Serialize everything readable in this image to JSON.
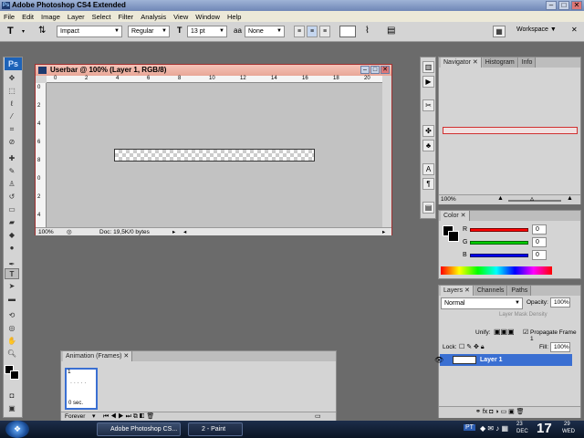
{
  "app": {
    "title": "Adobe Photoshop CS4 Extended",
    "logo": "Ps"
  },
  "menu": [
    "File",
    "Edit",
    "Image",
    "Layer",
    "Select",
    "Filter",
    "Analysis",
    "View",
    "Window",
    "Help"
  ],
  "options": {
    "font_family": "Impact",
    "font_style": "Regular",
    "font_size": "13 pt",
    "antialias_label": "aa",
    "antialias": "None",
    "workspace": "Workspace"
  },
  "document": {
    "title": "Userbar @ 100% (Layer 1, RGB/8)",
    "zoom": "100%",
    "doc_info": "Doc: 19,5K/0 bytes",
    "ruler_h": [
      "0",
      "2",
      "4",
      "6",
      "8",
      "10",
      "12",
      "14",
      "16",
      "18",
      "20"
    ],
    "ruler_v": [
      "0",
      "2",
      "4",
      "6",
      "8",
      "0",
      "2",
      "4"
    ]
  },
  "navigator": {
    "tabs": [
      "Navigator",
      "Histogram",
      "Info"
    ],
    "zoom": "100%"
  },
  "color": {
    "tab": "Color",
    "channels": [
      {
        "label": "R",
        "value": "0"
      },
      {
        "label": "G",
        "value": "0"
      },
      {
        "label": "B",
        "value": "0"
      }
    ],
    "colors": {
      "fg": "#000000",
      "r": "#ff0000",
      "g": "#00c000",
      "b": "#0000ff"
    }
  },
  "layers": {
    "tabs": [
      "Layers",
      "Channels",
      "Paths"
    ],
    "blend_mode": "Normal",
    "opacity_label": "Opacity:",
    "opacity": "100%",
    "mask_density": "Layer Mask Density",
    "unify": "Unify:",
    "propagate": "Propagate Frame 1",
    "lock": "Lock:",
    "fill_label": "Fill:",
    "fill": "100%",
    "layer_name": "Layer 1",
    "bottom_icons": "fx"
  },
  "animation": {
    "title": "Animation (Frames)",
    "frame_number": "1",
    "frame_delay": "0 sec.",
    "loop": "Forever"
  },
  "taskbar": {
    "items": [
      "Adobe Photoshop CS...",
      "2 - Paint"
    ],
    "lang": "PT",
    "date_month": "DEC",
    "date_day": "23",
    "time": "17",
    "time2": "29",
    "weekday": "WED"
  }
}
